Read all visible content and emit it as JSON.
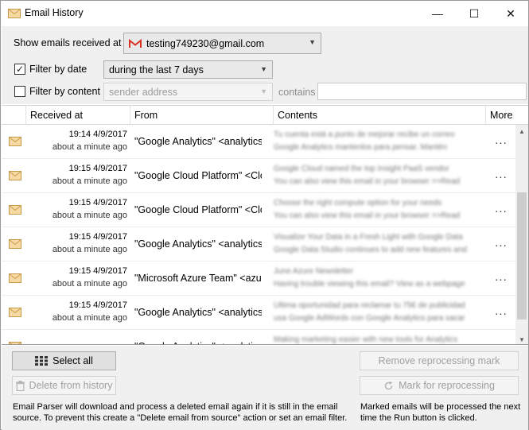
{
  "window": {
    "title": "Email History",
    "minimize_glyph": "—",
    "maximize_glyph": "☐",
    "close_glyph": "✕",
    "icon": "envelope-icon"
  },
  "filters": {
    "show_label": "Show emails received at",
    "account": "testing749230@gmail.com",
    "account_icon": "gmail-icon",
    "filter_by_date": {
      "label": "Filter by date",
      "checked": true,
      "value": "during the last 7 days"
    },
    "filter_by_content": {
      "label": "Filter by content",
      "checked": false,
      "placeholder": "sender address"
    },
    "contains_label": "contains",
    "contains_value": ""
  },
  "grid": {
    "columns": [
      "Received at",
      "From",
      "Contents",
      "More"
    ],
    "rows": [
      {
        "time": "19:14 4/9/2017",
        "ago": "about a minute ago",
        "from": "\"Google Analytics\" <analytics-",
        "contents_line1": "Tu cuenta está a punto de mejorar recibe un correo",
        "contents_line2": "Google Analytics   mantenlos para pensar.   Mantén",
        "more": "..."
      },
      {
        "time": "19:15 4/9/2017",
        "ago": "about a minute ago",
        "from": "\"Google Cloud Platform\" <Clo",
        "contents_line1": "Google Cloud named the top Insight PaaS vendor",
        "contents_line2": "   You can also view this email in your browser   >>Read",
        "more": "..."
      },
      {
        "time": "19:15 4/9/2017",
        "ago": "about a minute ago",
        "from": "\"Google Cloud Platform\" <Clo",
        "contents_line1": "Choose the right compute option for your needs",
        "contents_line2": "   You can also view this email in your browser   >>Read",
        "more": "..."
      },
      {
        "time": "19:15 4/9/2017",
        "ago": "about a minute ago",
        "from": "\"Google Analytics\" <analytics-",
        "contents_line1": "Visualize Your Data in a Fresh Light with Google Data",
        "contents_line2": "Google Data Studio continues to add new features and",
        "more": "..."
      },
      {
        "time": "19:15 4/9/2017",
        "ago": "about a minute ago",
        "from": "\"Microsoft Azure Team\" <azur",
        "contents_line1": "June Azure Newsletter",
        "contents_line2": "Having trouble viewing this email? View as a webpage",
        "more": "..."
      },
      {
        "time": "19:15 4/9/2017",
        "ago": "about a minute ago",
        "from": "\"Google Analytics\" <analytics-",
        "contents_line1": "Última oportunidad para reclamar tu 75€ de publicidad",
        "contents_line2": "   usa Google AdWords con Google Analytics para sacar",
        "more": "..."
      },
      {
        "time": "",
        "ago": "",
        "from": "\"Google Analytics\" <analytics-",
        "contents_line1": "Making marketing easier with new tools for Analytics",
        "contents_line2": "",
        "more": ""
      }
    ]
  },
  "actions": {
    "select_all": "Select all",
    "delete_from_history": "Delete from history",
    "remove_reprocessing_mark": "Remove reprocessing mark",
    "mark_for_reprocessing": "Mark for reprocessing",
    "note_left": "Email Parser will download and process a deleted email again if it is still in the email source. To prevent this create a \"Delete email from source\" action or set an email filter.",
    "note_right": "Marked emails will be processed the next time the Run button is clicked."
  },
  "colors": {
    "panel_bg": "#f0f0f0",
    "envelope_fill": "#f6d9a3",
    "gmail_red": "#d93025"
  }
}
